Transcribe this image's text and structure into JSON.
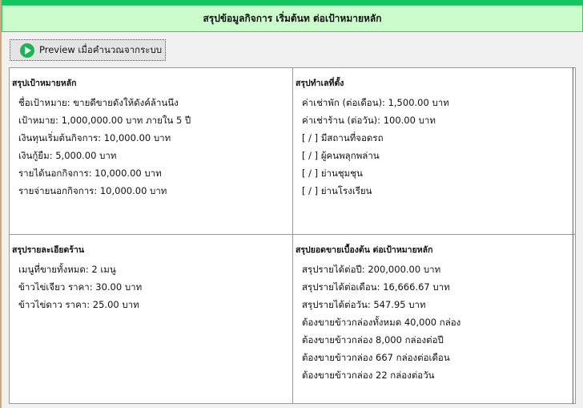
{
  "header": {
    "title": "สรุปข้อมูลกิจการ เริ่มต้นท ต่อเป้าหมายหลัก"
  },
  "toolbar": {
    "preview_label": "Preview เมื่อคำนวณจากระบบ"
  },
  "panels": [
    {
      "title": "สรุปเป้าหมายหลัก",
      "lines": [
        "ชื่อเป้าหมาย: ขายดีขายดังให้ดังค์ล้านนึง",
        "เป้าหมาย: 1,000,000.00 บาท ภายใน 5 ปี",
        "เงินทุนเริ่มต้นกิจการ: 10,000.00 บาท",
        "เงินกู้ยืม: 5,000.00 บาท",
        "รายได้นอกกิจการ: 10,000.00 บาท",
        "รายจ่ายนอกกิจการ: 10,000.00 บาท"
      ]
    },
    {
      "title": "สรุปทำเลที่ตั้ง",
      "lines": [
        "ค่าเช่าพัก (ต่อเดือน): 1,500.00 บาท",
        "ค่าเช่าร้าน (ต่อวัน): 100.00 บาท",
        "[ / ] มีสถานที่จอดรถ",
        "[ / ] ผู้คนพลุกพล่าน",
        "[ / ] ย่านชุมชุน",
        "[ / ] ย่านโรงเรียน"
      ]
    },
    {
      "title": "สรุปรายละเอียดร้าน",
      "lines": [
        "เมนูที่ขายทั้งหมด: 2 เมนู",
        "ข้าวไข่เจียว ราคา: 30.00 บาท",
        "ข้าวไข่ดาว ราคา: 25.00 บาท"
      ]
    },
    {
      "title": "สรุปยอดขายเบื้องต้น ต่อเป้าหมายหลัก",
      "lines": [
        "สรุปรายได้ต่อปี: 200,000.00 บาท",
        "สรุปรายได้ต่อเดือน: 16,666.67 บาท",
        "สรุปรายได้ต่อวัน: 547.95 บาท",
        "ต้องขายข้าวกล่องทั้งหมด 40,000 กล่อง",
        "ต้องขายข้าวกล่อง 8,000 กล่องต่อปี",
        "ต้องขายข้าวกล่อง 667 กล่องต่อเดือน",
        "ต้องขายข้าวกล่อง 22 กล่องต่อวัน"
      ]
    }
  ]
}
